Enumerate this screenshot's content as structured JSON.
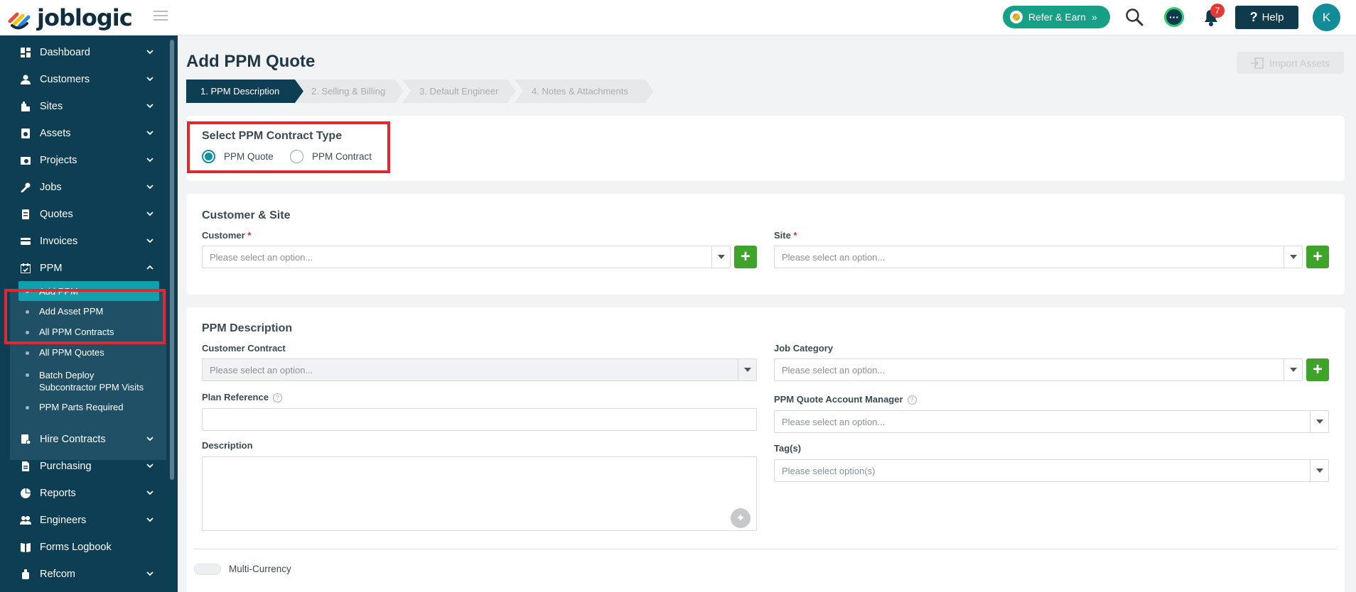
{
  "app": {
    "logo_text": "joblogic",
    "refer_label": "Refer & Earn",
    "notification_count": "7",
    "help_label": "Help",
    "avatar_initial": "K"
  },
  "sidebar": {
    "items": [
      {
        "label": "Dashboard",
        "icon": "dashboard-icon"
      },
      {
        "label": "Customers",
        "icon": "user-icon"
      },
      {
        "label": "Sites",
        "icon": "building-icon"
      },
      {
        "label": "Assets",
        "icon": "asset-icon"
      },
      {
        "label": "Projects",
        "icon": "projects-icon"
      },
      {
        "label": "Jobs",
        "icon": "wrench-icon"
      },
      {
        "label": "Quotes",
        "icon": "quote-icon"
      },
      {
        "label": "Invoices",
        "icon": "invoice-icon"
      },
      {
        "label": "PPM",
        "icon": "calendar-icon"
      },
      {
        "label": "Hire Contracts",
        "icon": "contract-icon"
      },
      {
        "label": "Purchasing",
        "icon": "document-icon"
      },
      {
        "label": "Reports",
        "icon": "reports-icon"
      },
      {
        "label": "Engineers",
        "icon": "engineers-icon"
      },
      {
        "label": "Forms Logbook",
        "icon": "book-icon"
      },
      {
        "label": "Refcom",
        "icon": "refcom-icon"
      }
    ],
    "ppm_sub": [
      {
        "label": "Add PPM"
      },
      {
        "label": "Add Asset PPM"
      },
      {
        "label": "All PPM Contracts"
      },
      {
        "label": "All PPM Quotes"
      },
      {
        "label": "Batch Deploy Subcontractor PPM Visits"
      },
      {
        "label": "PPM Parts Required"
      }
    ]
  },
  "main": {
    "title": "Add PPM Quote",
    "import_label": "Import Assets",
    "steps": [
      {
        "label": "1. PPM Description"
      },
      {
        "label": "2. Selling & Billing"
      },
      {
        "label": "3. Default Engineer"
      },
      {
        "label": "4. Notes & Attachments"
      }
    ],
    "contract_type": {
      "title": "Select PPM Contract Type",
      "options": [
        "PPM Quote",
        "PPM Contract"
      ],
      "selected": "PPM Quote"
    },
    "customer_site": {
      "title": "Customer & Site",
      "customer_label": "Customer",
      "site_label": "Site",
      "required_mark": "*",
      "customer_placeholder": "Please select an option...",
      "site_placeholder": "Please select an option..."
    },
    "ppm_description": {
      "title": "PPM Description",
      "customer_contract_label": "Customer Contract",
      "customer_contract_placeholder": "Please select an option...",
      "job_category_label": "Job Category",
      "job_category_placeholder": "Please select an option...",
      "plan_reference_label": "Plan Reference",
      "account_manager_label": "PPM Quote Account Manager",
      "account_manager_placeholder": "Please select an option...",
      "description_label": "Description",
      "tags_label": "Tag(s)",
      "tags_placeholder": "Please select option(s)",
      "help_mark": "?"
    },
    "multi_currency_label": "Multi-Currency"
  },
  "colors": {
    "sidebar_bg": "#0e3e53",
    "accent": "#11a0ad",
    "add_button": "#3fa32b",
    "highlight": "#e0282e"
  }
}
